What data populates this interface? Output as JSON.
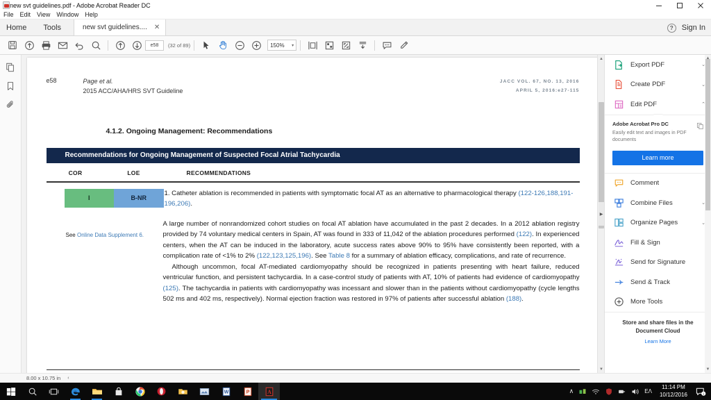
{
  "window": {
    "title": "new svt guidelines.pdf - Adobe Acrobat Reader DC",
    "minimize": "–",
    "maximize": "❐",
    "close": "✕"
  },
  "menubar": {
    "items": [
      "File",
      "Edit",
      "View",
      "Window",
      "Help"
    ]
  },
  "tabbar": {
    "home": "Home",
    "tools": "Tools",
    "doc_tab": "new svt guidelines....",
    "doc_tab_close": "✕",
    "help": "?",
    "sign_in": "Sign In"
  },
  "toolbar": {
    "page_value": "e58",
    "page_count": "(32 of 89)",
    "zoom_value": "150%",
    "zoom_caret": "▾",
    "icons": [
      "save-icon",
      "upload-icon",
      "print-icon",
      "email-icon",
      "undo-icon",
      "search-icon",
      "previous-page-icon",
      "next-page-icon",
      "select-tool-icon",
      "hand-tool-icon",
      "zoom-out-icon",
      "zoom-in-icon",
      "fit-width-icon",
      "page-display-icon",
      "fullscreen-icon",
      "scroll-mode-icon",
      "comment-icon",
      "highlight-icon"
    ]
  },
  "left_rail": {
    "items": [
      "page-thumbnails-icon",
      "bookmarks-icon",
      "attachments-icon"
    ]
  },
  "document": {
    "running_head": {
      "page_label": "e58",
      "authors": "Page et al.",
      "guideline": "2015 ACC/AHA/HRS SVT Guideline",
      "journal_line1": "JACC VOL. 67, NO. 13, 2016",
      "journal_line2": "APRIL 5, 2016:e27-115"
    },
    "section_heading": "4.1.2. Ongoing Management: Recommendations",
    "recommendation_banner": "Recommendations for Ongoing Management of Suspected Focal Atrial Tachycardia",
    "table": {
      "headers": {
        "cor": "COR",
        "loe": "LOE",
        "recommendations": "RECOMMENDATIONS"
      },
      "row": {
        "cor_value": "I",
        "loe_value": "B-NR",
        "cor_color": "#68bd7f",
        "loe_color": "#6fa4d8",
        "recommendation_lead": "1. Catheter ablation is recommended in patients with symptomatic focal AT as an alternative to pharmacological therapy ",
        "recommendation_refs": "(122-126,188,191-196,206)",
        "recommendation_tail": "."
      },
      "supplement_prefix": "See ",
      "supplement_link": "Online Data Supplement 6."
    },
    "body": {
      "para1_a": "A large number of nonrandomized cohort studies on focal AT ablation have accumulated in the past 2 decades. In a 2012 ablation registry provided by 74 voluntary medical centers in Spain, AT was found in 333 of 11,042 of the ablation procedures performed ",
      "para1_ref1": "(122)",
      "para1_b": ". In experienced centers, when the AT can be induced in the laboratory, acute success rates above 90% to 95% have consistently been reported, with a complication rate of <1% to 2% ",
      "para1_ref2": "(122,123,125,196)",
      "para1_c": ". See ",
      "para1_ref3": "Table 8",
      "para1_d": " for a summary of ablation efficacy, complications, and rate of recurrence.",
      "para2_a": "Although uncommon, focal AT-mediated cardiomyopathy should be recognized in patients presenting with heart failure, reduced ventricular function, and persistent tachycardia. In a case-control study of patients with AT, 10% of patients had evidence of cardiomyopathy ",
      "para2_ref1": "(125)",
      "para2_b": ". The tachycardia in patients with cardiomyopathy was incessant and slower than in the patients without cardiomyopathy (cycle lengths 502 ms and 402 ms, respectively). Normal ejection fraction was restored in 97% of patients after successful ablation ",
      "para2_ref2": "(188)",
      "para2_c": "."
    }
  },
  "tools_pane": {
    "items": [
      {
        "label": "Export PDF",
        "icon": "export-pdf-icon",
        "chevron": "⌄",
        "expanded": false
      },
      {
        "label": "Create PDF",
        "icon": "create-pdf-icon",
        "chevron": "⌄",
        "expanded": false
      },
      {
        "label": "Edit PDF",
        "icon": "edit-pdf-icon",
        "chevron": "⌃",
        "expanded": true
      }
    ],
    "promo": {
      "title": "Adobe Acrobat Pro DC",
      "description": "Easily edit text and images in PDF documents",
      "button": "Learn more",
      "copy_icon": "copy-icon"
    },
    "items2": [
      {
        "label": "Comment",
        "icon": "comment-bubble-icon",
        "chevron": ""
      },
      {
        "label": "Combine Files",
        "icon": "combine-files-icon",
        "chevron": "⌄"
      },
      {
        "label": "Organize Pages",
        "icon": "organize-pages-icon",
        "chevron": "⌄"
      },
      {
        "label": "Fill & Sign",
        "icon": "fill-sign-icon",
        "chevron": ""
      },
      {
        "label": "Send for Signature",
        "icon": "send-signature-icon",
        "chevron": ""
      },
      {
        "label": "Send & Track",
        "icon": "send-track-icon",
        "chevron": ""
      },
      {
        "label": "More Tools",
        "icon": "more-tools-icon",
        "chevron": ""
      }
    ],
    "cloud": {
      "title": "Store and share files in the Document Cloud",
      "link": "Learn More"
    }
  },
  "statusbar": {
    "dimensions": "8.00 x 10.75 in",
    "collapse": "‹"
  },
  "taskbar": {
    "items": [
      "windows-start-icon",
      "search-icon",
      "task-view-icon",
      "edge-icon",
      "file-explorer-icon",
      "microsoft-store-icon",
      "chrome-icon",
      "opera-icon",
      "folder-icon",
      "picture-viewer-icon",
      "word-icon",
      "powerpoint-icon",
      "acrobat-icon"
    ],
    "tray": {
      "overflow": "∧",
      "icons": [
        "network-icon",
        "wifi-icon",
        "security-icon",
        "bluetooth-icon",
        "volume-icon"
      ],
      "language": "EΛ",
      "time": "11:14 PM",
      "date": "10/12/2016",
      "notifications": "notification-center-icon",
      "badge": "1"
    }
  }
}
